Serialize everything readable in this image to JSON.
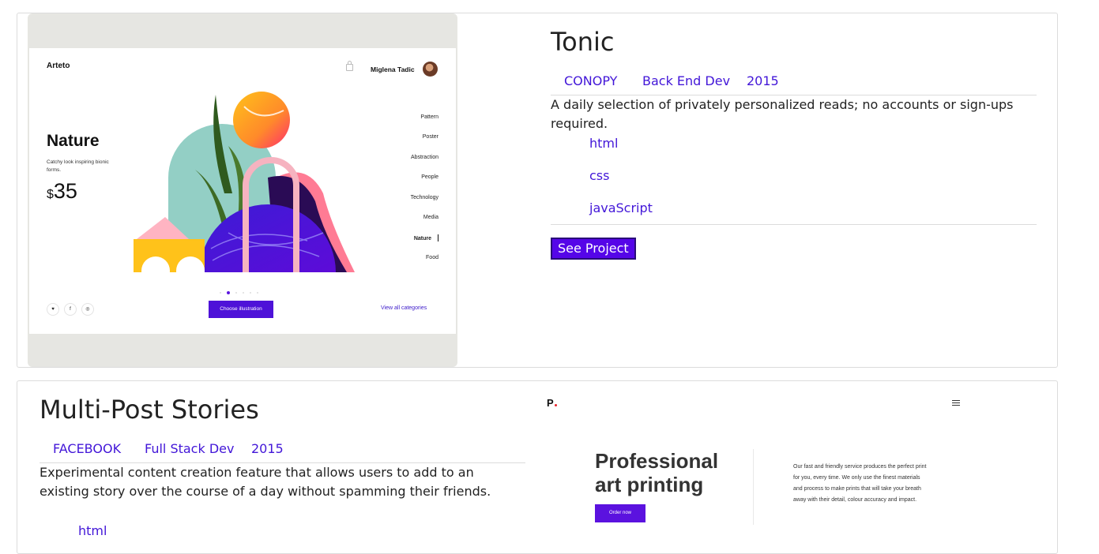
{
  "projects": [
    {
      "title": "Tonic",
      "client": "CONOPY",
      "role": "Back End Dev",
      "year": "2015",
      "description": "A daily selection of privately personalized reads; no accounts or sign-ups required.",
      "tech": [
        "html",
        "css",
        "javaScript"
      ],
      "button_label": "See Project",
      "screenshot": {
        "logo": "Arteto",
        "user_name": "Miglena Tadic",
        "hero_title": "Nature",
        "hero_subtitle": "Catchy look inspiring bionic forms.",
        "currency": "$",
        "price": "35",
        "categories": [
          "Pattern",
          "Poster",
          "Abstraction",
          "People",
          "Technology",
          "Media",
          "Nature",
          "Food"
        ],
        "active_category": "Nature",
        "social": [
          "twitter-icon",
          "facebook-icon",
          "instagram-icon"
        ],
        "social_glyphs": [
          "♥",
          "f",
          "◎"
        ],
        "cta": "Choose illustration",
        "link": "View all categories",
        "accent": "#4e12d8"
      }
    },
    {
      "title": "Multi-Post Stories",
      "client": "FACEBOOK",
      "role": "Full Stack Dev",
      "year": "2015",
      "description": "Experimental content creation feature that allows users to add to an existing story over the course of a day without spamming their friends.",
      "tech": [
        "html"
      ],
      "screenshot": {
        "logo": "P",
        "headline_line1": "Professional",
        "headline_line2": "art printing",
        "cta": "Order now",
        "body": "Our fast and friendly service produces the perfect print for you, every time. We only use the finest materials and process to make prints that will take your breath away with their detail, colour accuracy and impact.",
        "accent": "#5b12df"
      }
    }
  ],
  "colors": {
    "link": "#4216d8",
    "button": "#5505e8",
    "border": "#dcdcdc"
  }
}
